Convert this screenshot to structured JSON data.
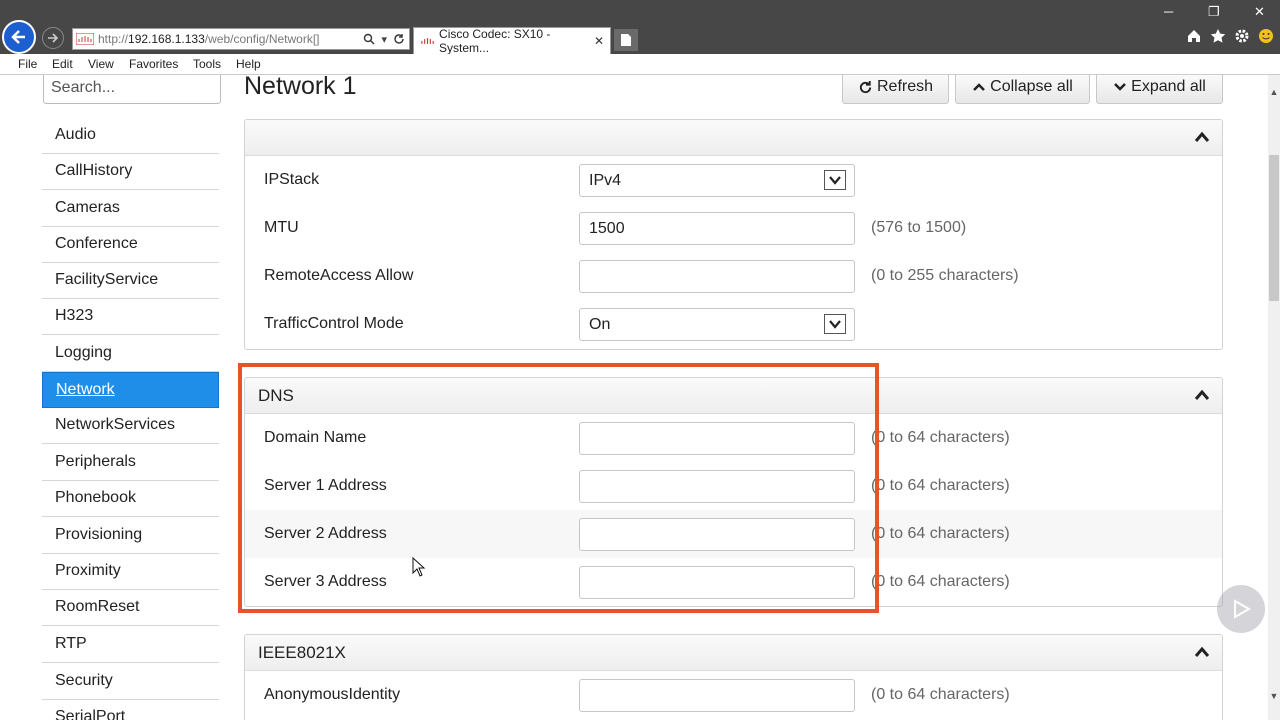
{
  "browser": {
    "url_prefix": "http://",
    "url_host": "192.168.1.133",
    "url_path": "/web/config/Network[]",
    "tab_title": "Cisco Codec: SX10 - System...",
    "menu": [
      "File",
      "Edit",
      "View",
      "Favorites",
      "Tools",
      "Help"
    ]
  },
  "sidebar": {
    "search_placeholder": "Search...",
    "items": [
      "Audio",
      "CallHistory",
      "Cameras",
      "Conference",
      "FacilityService",
      "H323",
      "Logging",
      "Network",
      "NetworkServices",
      "Peripherals",
      "Phonebook",
      "Provisioning",
      "Proximity",
      "RoomReset",
      "RTP",
      "Security",
      "SerialPort"
    ],
    "active_item": "Network"
  },
  "header": {
    "title": "Network 1",
    "refresh_label": "Refresh",
    "collapse_label": "Collapse all",
    "expand_label": "Expand all"
  },
  "sections": {
    "general": {
      "title": "",
      "rows": [
        {
          "label": "IPStack",
          "value": "IPv4",
          "hint": ""
        },
        {
          "label": "MTU",
          "value": "1500",
          "hint": "(576 to 1500)"
        },
        {
          "label": "RemoteAccess Allow",
          "value": "",
          "hint": "(0 to 255 characters)"
        },
        {
          "label": "TrafficControl Mode",
          "value": "On",
          "hint": ""
        }
      ]
    },
    "dns": {
      "title": "DNS",
      "rows": [
        {
          "label": "Domain Name",
          "value": "",
          "hint": "(0 to 64 characters)"
        },
        {
          "label": "Server 1 Address",
          "value": "",
          "hint": "(0 to 64 characters)"
        },
        {
          "label": "Server 2 Address",
          "value": "",
          "hint": "(0 to 64 characters)"
        },
        {
          "label": "Server 3 Address",
          "value": "",
          "hint": "(0 to 64 characters)"
        }
      ]
    },
    "ieee": {
      "title": "IEEE8021X",
      "rows": [
        {
          "label": "AnonymousIdentity",
          "value": "",
          "hint": "(0 to 64 characters)"
        }
      ]
    }
  },
  "colors": {
    "accent_active": "#1f8ee9",
    "highlight": "#e8542a"
  }
}
